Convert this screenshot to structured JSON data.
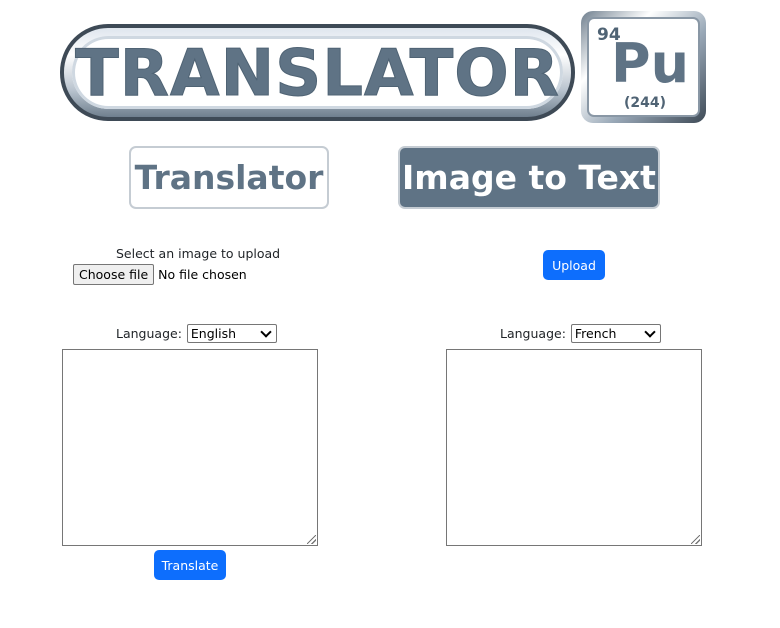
{
  "logo": {
    "wordmark": "TRANSLATOR",
    "element_number": "94",
    "element_symbol": "Pu",
    "element_mass": "(244)"
  },
  "modes": {
    "translator_label": "Translator",
    "image_to_text_label": "Image to Text",
    "active": "Image to Text"
  },
  "upload": {
    "prompt": "Select an image to upload",
    "choose_file_label": "Choose file",
    "no_file_text": "No file chosen",
    "upload_button": "Upload"
  },
  "source": {
    "language_label": "Language:",
    "language": "English",
    "text": ""
  },
  "target": {
    "language_label": "Language:",
    "language": "French",
    "text": ""
  },
  "translate_button": "Translate",
  "colors": {
    "primary": "#0d6efd",
    "brand": "#5f7385"
  }
}
